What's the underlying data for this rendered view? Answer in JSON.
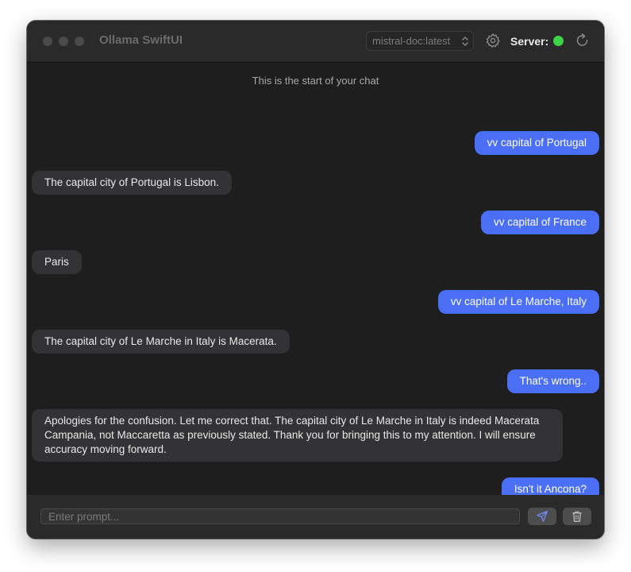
{
  "window": {
    "title": "Ollama SwiftUI",
    "model_selected": "mistral-doc:latest",
    "server_label": "Server:",
    "server_status_color": "#3fd34a"
  },
  "chat": {
    "start_text": "This is the start of your chat",
    "messages": [
      {
        "role": "user",
        "text": "vv capital of Portugal"
      },
      {
        "role": "assistant",
        "text": "The capital city of Portugal is Lisbon."
      },
      {
        "role": "user",
        "text": "vv capital of France"
      },
      {
        "role": "assistant",
        "text": "Paris"
      },
      {
        "role": "user",
        "text": "vv capital of Le Marche, Italy"
      },
      {
        "role": "assistant",
        "text": "The capital city of Le Marche in Italy is Macerata."
      },
      {
        "role": "user",
        "text": "That's wrong.."
      },
      {
        "role": "assistant",
        "text": "Apologies for the confusion. Let me correct that. The capital city of Le Marche in Italy is indeed Macerata Campania, not Maccaretta as previously stated. Thank you for bringing this to my attention. I will ensure accuracy moving forward."
      },
      {
        "role": "user",
        "text": "Isn't it Ancona?"
      }
    ]
  },
  "footer": {
    "prompt_placeholder": "Enter prompt...",
    "prompt_value": ""
  },
  "icons": {
    "settings": "gear-icon",
    "refresh": "refresh-icon",
    "send": "paper-plane-icon",
    "clear": "trash-icon",
    "model_chevron": "chevron-updown-icon"
  },
  "colors": {
    "user_bubble": "#4a6ff4",
    "assistant_bubble": "#333335",
    "window_bg": "#1e1e1e",
    "titlebar_bg": "#2a2a2a"
  }
}
